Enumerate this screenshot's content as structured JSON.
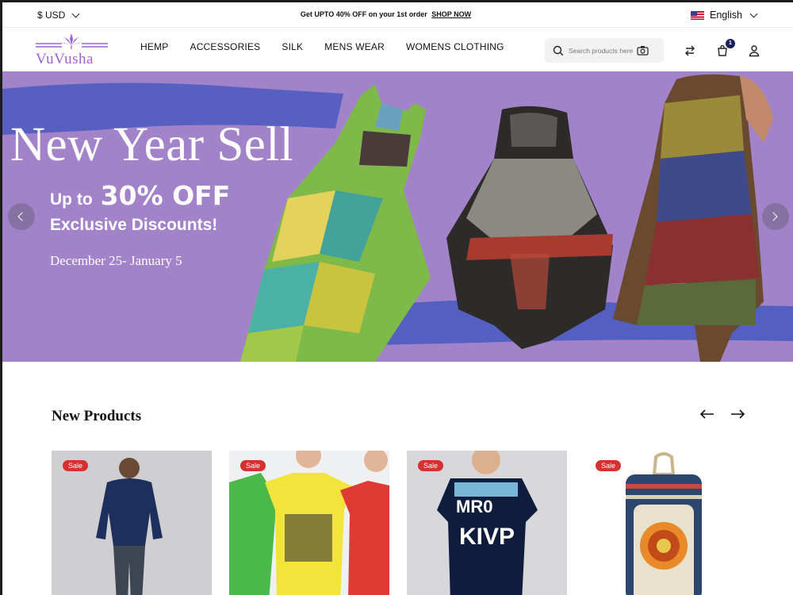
{
  "topbar": {
    "currency": "$ USD",
    "promo_text": "Get UPTO 40% OFF on your 1st order",
    "promo_link": "SHOP NOW",
    "language": "English"
  },
  "header": {
    "logo_text": "VuVusha",
    "nav": [
      "HEMP",
      "ACCESSORIES",
      "SILK",
      "MENS WEAR",
      "WOMENS CLOTHING"
    ],
    "search_placeholder": "Search products here",
    "cart_count": "1"
  },
  "hero": {
    "title": "New Year Sell",
    "upto": "Up to",
    "discount": "30% OFF",
    "subtitle": "Exclusive Discounts!",
    "dates": "December 25- January 5",
    "background_color": "#a283c9"
  },
  "products_section": {
    "title": "New Products",
    "cards": [
      {
        "badge": "Sale",
        "image": "man-hoodie-jeans"
      },
      {
        "badge": "Sale",
        "image": "kids-colored-tshirts"
      },
      {
        "badge": "Sale",
        "image": "boy-navy-print-tshirt"
      },
      {
        "badge": "Sale",
        "image": "hemp-mandala-backpack"
      }
    ]
  },
  "colors": {
    "accent": "#9c63cf",
    "sale_badge": "#d8302f",
    "cart_badge": "#1a1f5c"
  }
}
